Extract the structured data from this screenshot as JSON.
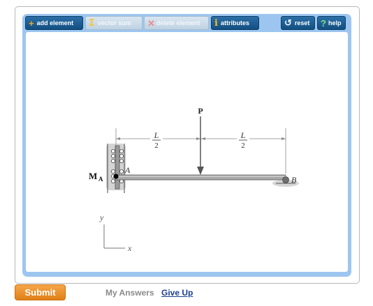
{
  "toolbar": {
    "add_element": "add element",
    "vector_sum": "vector sum",
    "delete_element": "delete element",
    "attributes": "attributes",
    "reset": "reset",
    "help": "help"
  },
  "diagram": {
    "force_label": "P",
    "length_numerator_left": "L",
    "length_denominator_left": "2",
    "length_numerator_right": "L",
    "length_denominator_right": "2",
    "moment_label": "M",
    "moment_subscript": "A",
    "point_a_label": "A",
    "point_b_label": "B",
    "y_axis_label": "y",
    "x_axis_label": "x"
  },
  "footer": {
    "submit": "Submit",
    "my_answers": "My Answers",
    "give_up": "Give Up"
  },
  "colors": {
    "panel": "#9cc6ef",
    "toolbar_active": "#1f5f94",
    "submit": "#ee9026",
    "link": "#1a3e8f"
  }
}
